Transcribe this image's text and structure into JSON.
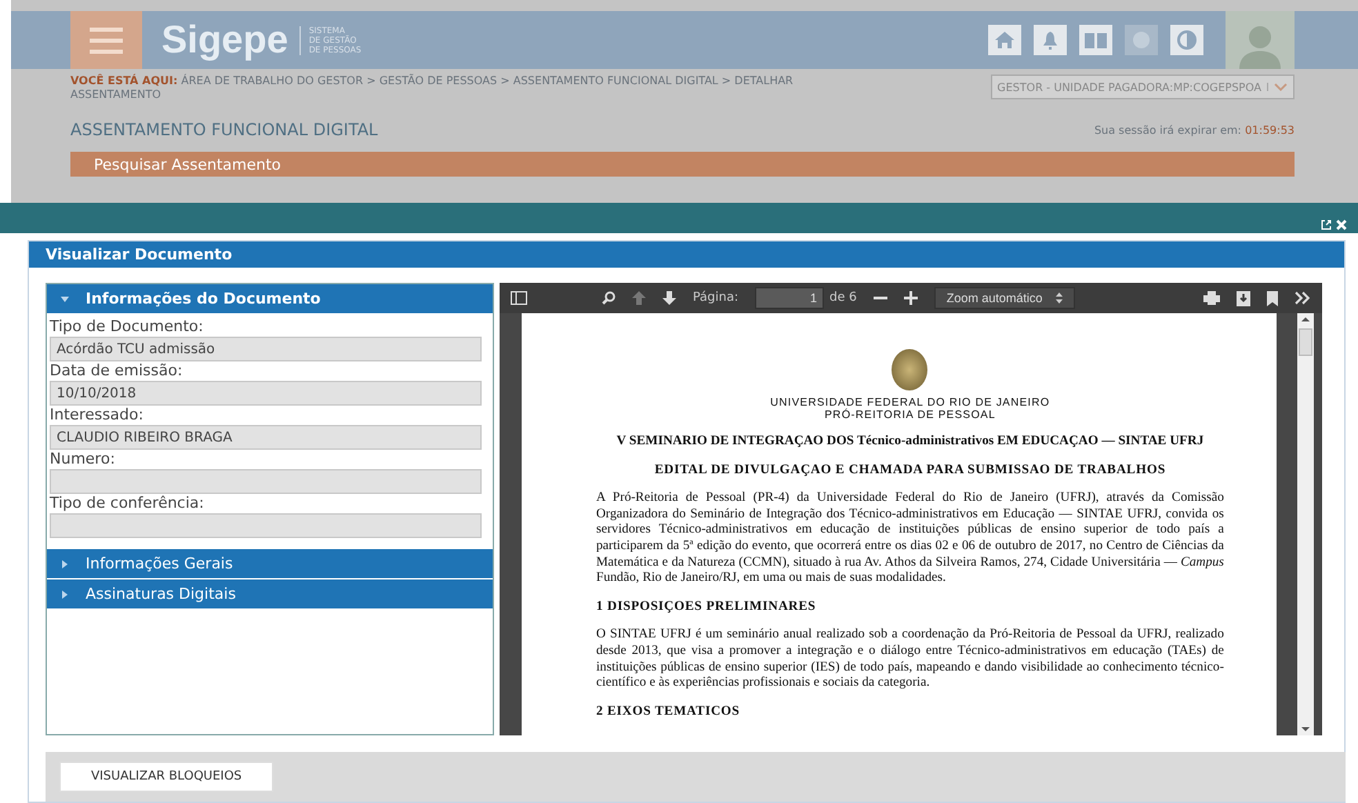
{
  "background_page": {
    "logo": "Sigepe",
    "logo_subtitle": [
      "SISTEMA",
      "DE GESTÃO",
      "DE PESSOAS"
    ],
    "breadcrumb_label": "VOCÊ ESTÁ AQUI:",
    "breadcrumb": "ÁREA DE TRABALHO DO GESTOR > GESTÃO DE PESSOAS > ASSENTAMENTO FUNCIONAL DIGITAL > DETALHAR ASSENTAMENTO",
    "profile_select": "GESTOR - UNIDADE PAGADORA:MP:COGEPSPOA",
    "page_title": "ASSENTAMENTO FUNCIONAL DIGITAL",
    "session_label": "Sua sessão irá expirar em:",
    "session_time": "01:59:53",
    "search_tab": "Pesquisar Assentamento"
  },
  "dialog": {
    "title": "Visualizar Documento",
    "sections": [
      {
        "title": "Informações do Documento",
        "expanded": true,
        "fields": [
          {
            "label": "Tipo de Documento:",
            "value": "Acórdão TCU admissão"
          },
          {
            "label": "Data de emissão:",
            "value": "10/10/2018"
          },
          {
            "label": "Interessado:",
            "value": "CLAUDIO RIBEIRO BRAGA"
          },
          {
            "label": "Numero:"
          },
          {
            "label": "Tipo de conferência:"
          }
        ]
      },
      {
        "title": "Informações Gerais",
        "expanded": false
      },
      {
        "title": "Assinaturas Digitais",
        "expanded": false
      }
    ],
    "viewer": {
      "page_label": "Página:",
      "page_value": "1",
      "page_count": "de 6",
      "zoom": "Zoom automático",
      "document": {
        "header_lines": [
          "UNIVERSIDADE FEDERAL DO RIO DE JANEIRO",
          "PRÓ-REITORIA DE PESSOAL"
        ],
        "title": "V SEMINARIO DE INTEGRAÇAO DOS Técnico-administrativos EM EDUCAÇAO — SINTAE UFRJ",
        "subtitle": "EDITAL DE DIVULGAÇAO E CHAMADA PARA SUBMISSAO DE TRABALHOS",
        "blocks": [
          {
            "kind": "paragraph",
            "text": "A Pró-Reitoria de Pessoal (PR-4) da Universidade Federal do Rio de Janeiro (UFRJ), através da Comissão Organizadora do Seminário de Integração dos Técnico-administrativos em Educação — SINTAE UFRJ, convida os servidores Técnico-administrativos em educação de instituições públicas de ensino superior de todo país a participarem da 5ª edição do evento, que ocorrerá entre os dias 02 e 06 de outubro de 2017, no Centro de Ciências da Matemática e da Natureza (CCMN), situado à rua Av. Athos da Silveira Ramos, 274, Cidade Universitária — *Campus* Fundão, Rio de Janeiro/RJ, em uma ou mais de suas modalidades."
          },
          {
            "kind": "heading",
            "text": "1 DISPOSIÇOES PRELIMINARES"
          },
          {
            "kind": "paragraph",
            "text": "O SINTAE UFRJ é um seminário anual realizado sob a coordenação da Pró-Reitoria de Pessoal da UFRJ, realizado desde 2013, que visa a promover a integração e o diálogo entre Técnico-administrativos em educação (TAEs) de instituições públicas de ensino superior (IES) de todo país, mapeando e dando visibilidade ao conhecimento técnico-científico e às experiências profissionais e sociais da categoria."
          },
          {
            "kind": "heading",
            "text": "2 EIXOS TEMATICOS"
          }
        ]
      }
    },
    "buttons": [
      "VISUALIZAR BLOQUEIOS"
    ]
  }
}
